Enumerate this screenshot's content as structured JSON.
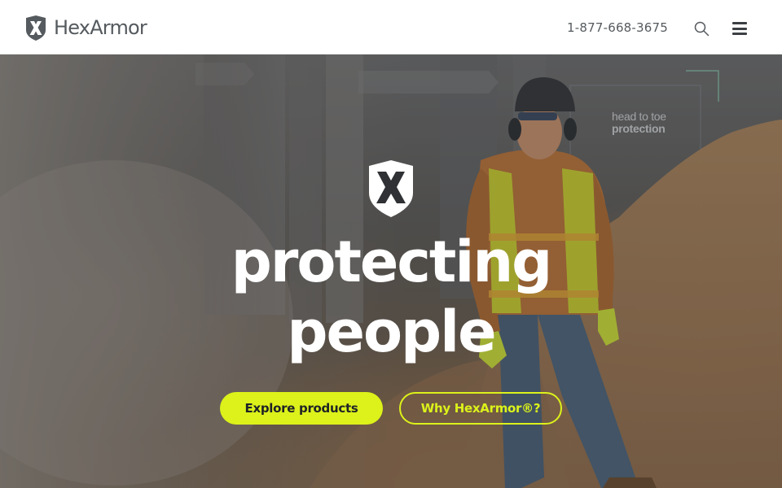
{
  "header": {
    "brand_name": "HexArmor",
    "phone": "1-877-668-3675",
    "icons": {
      "logo": "hex-x-shield-icon",
      "search": "search-icon",
      "menu": "hamburger-menu-icon"
    }
  },
  "hero": {
    "corner_tag_line1": "head to toe",
    "corner_tag_line2": "protection",
    "headline_line1": "protecting",
    "headline_line2": "people",
    "cta_primary": "Explore products",
    "cta_secondary": "Why HexArmor®?",
    "icons": {
      "emblem": "hex-x-shield-icon"
    }
  },
  "colors": {
    "accent": "#dcf21a",
    "text_dark": "#555a5e",
    "white": "#ffffff"
  }
}
